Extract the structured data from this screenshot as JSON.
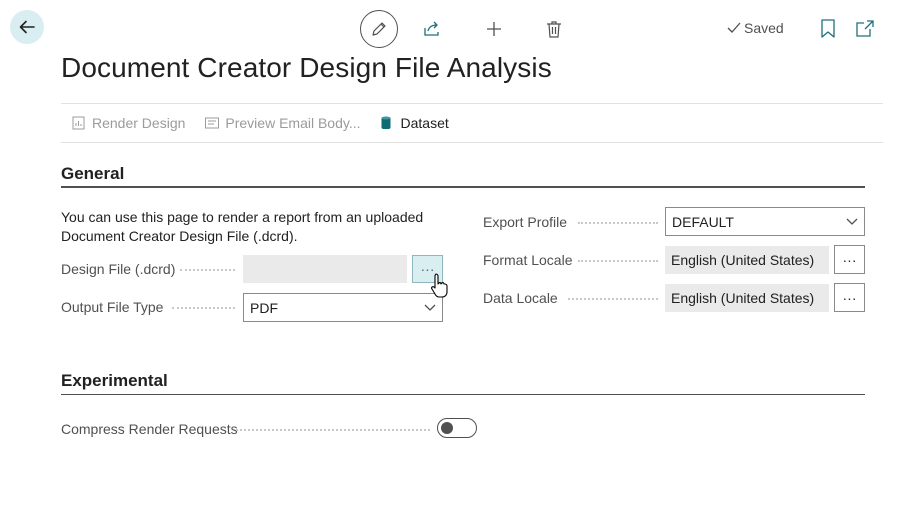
{
  "topbar": {
    "saved_label": "Saved"
  },
  "page": {
    "title": "Document Creator Design File Analysis"
  },
  "actions": {
    "render_design": "Render Design",
    "preview_email_body": "Preview Email Body...",
    "dataset": "Dataset"
  },
  "general": {
    "title": "General",
    "description": "You can use this page to render a report from an uploaded Document Creator Design File (.dcrd).",
    "design_file_label": "Design File (.dcrd)",
    "design_file_value": "",
    "output_file_type_label": "Output File Type",
    "output_file_type_value": "PDF",
    "export_profile_label": "Export Profile",
    "export_profile_value": "DEFAULT",
    "format_locale_label": "Format Locale",
    "format_locale_value": "English (United States)",
    "data_locale_label": "Data Locale",
    "data_locale_value": "English (United States)",
    "assist_symbol": "···"
  },
  "experimental": {
    "title": "Experimental",
    "compress_label": "Compress Render Requests",
    "compress_enabled": false
  },
  "colors": {
    "accent_teal": "#d8eef0",
    "dataset_icon": "#0f6a73",
    "text": "#212121",
    "muted": "#9b9b9b"
  },
  "icons": [
    "back-arrow-icon",
    "pencil-icon",
    "share-icon",
    "plus-icon",
    "trash-icon",
    "checkmark-icon",
    "bookmark-icon",
    "popout-icon",
    "report-icon",
    "email-icon",
    "database-icon",
    "chevron-down-icon",
    "hand-cursor-icon"
  ]
}
